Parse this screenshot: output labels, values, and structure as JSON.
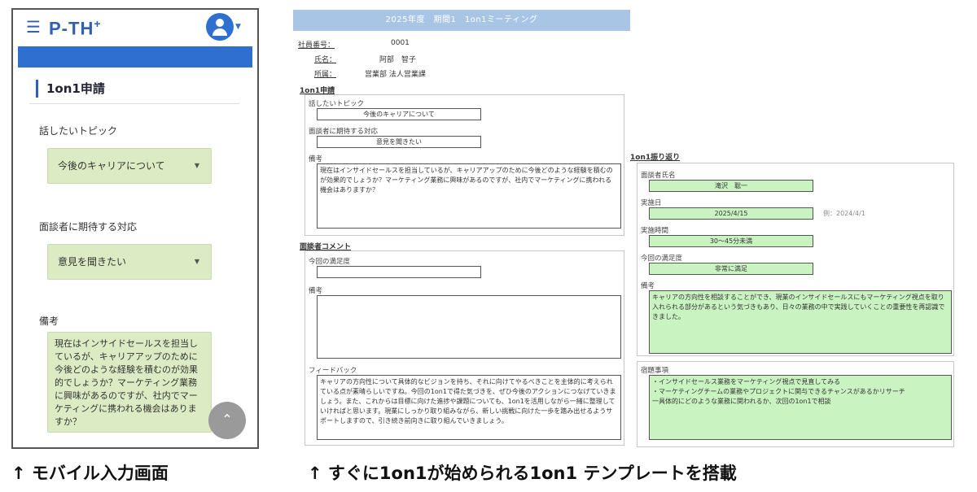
{
  "mobile": {
    "logo": "P-TH",
    "logo_sup": "+",
    "section_title": "1on1申請",
    "topic_label": "話したいトピック",
    "topic_value": "今後のキャリアについて",
    "expect_label": "面談者に期待する対応",
    "expect_value": "意見を聞きたい",
    "note_label": "備考",
    "note_value": "現在はインサイドセールスを担当しているが、キャリアアップのために今後どのような経験を積むのが効果的でしょうか？マーケティング業務に興味があるのですが、社内でマーケティングに携われる機会はありますか？"
  },
  "captions": {
    "left": "↑ モバイル入力画面",
    "right": "↑ すぐに1on1が始められる1on1 テンプレートを搭載"
  },
  "template": {
    "title": "2025年度　期間1　1on1ミーティング",
    "employee_no_label": "社員番号：",
    "employee_no": "0001",
    "name_label": "氏名：",
    "name": "阿部　智子",
    "dept_label": "所属：",
    "dept": "営業部 法人営業課",
    "apply": {
      "title": "1on1申請",
      "topic_label": "話したいトピック",
      "topic_value": "今後のキャリアについて",
      "expect_label": "面談者に期待する対応",
      "expect_value": "意見を聞きたい",
      "note_label": "備考",
      "note_value": "現在はインサイドセールスを担当しているが、キャリアアップのために今後どのような経験を積むのが効果的でしょうか？マーケティング業務に興味があるのですが、社内でマーケティングに携われる機会はありますか？"
    },
    "comment": {
      "title": "面談者コメント",
      "satisfaction_label": "今回の満足度",
      "satisfaction_value": "",
      "note_label": "備考",
      "note_value": "",
      "feedback_label": "フィードバック",
      "feedback_value": "キャリアの方向性について具体的なビジョンを持ち、それに向けてやるべきことを主体的に考えられている点が素晴らしいですね。今回の1on1で得た気づきを、ぜひ今後のアクションにつなげていきましょう。また、これからは目標に向けた進捗や課題についても、1on1を活用しながら一緒に整理していければと思います。現業にしっかり取り組みながら、新しい挑戦に向けた一歩を踏み出せるようサポートしますので、引き続き前向きに取り組んでいきましょう。"
    },
    "review": {
      "title": "1on1振り返り",
      "interviewer_label": "面談者氏名",
      "interviewer_value": "滝沢　聡一",
      "date_label": "実施日",
      "date_value": "2025/4/15",
      "date_example": "例：2024/4/1",
      "duration_label": "実施時間",
      "duration_value": "30〜45分未満",
      "satisfaction_label": "今回の満足度",
      "satisfaction_value": "非常に満足",
      "note_label": "備考",
      "note_value": "キャリアの方向性を相談することができ、現業のインサイドセールスにもマーケティング視点を取り入れられる部分があるという気づきもあり、日々の業務の中で実践していくことの重要性を再認識できました。",
      "todo_label": "宿題事項",
      "todo_value": "・インサイドセールス業務をマーケティング視点で見直してみる\n・マーケティングチームの業務やプロジェクトに関与できるチャンスがあるかリサーチ\n一具体的にどのような業務に関われるか、次回の1on1で相談"
    }
  },
  "icons": {
    "menu": "hamburger-icon",
    "avatar": "user-avatar-icon",
    "scroll_top": "chevron-up-icon"
  },
  "colors": {
    "brand": "#2f5fb3",
    "header_bar": "#2f6fd0",
    "field_green": "#dcebc3",
    "template_green": "#c9f3c1",
    "title_bar": "#a9c5e6"
  }
}
